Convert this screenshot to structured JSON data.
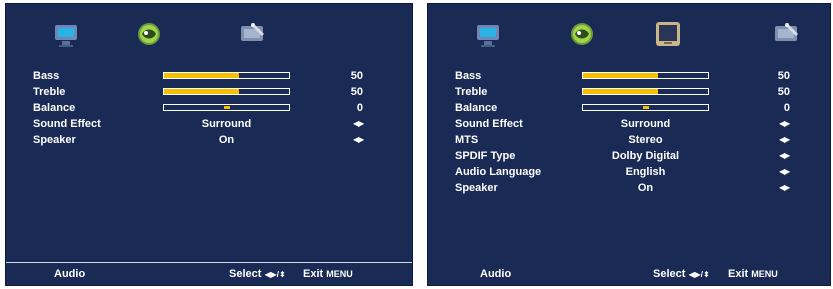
{
  "left": {
    "rows": [
      {
        "label": "Bass",
        "type": "slider",
        "value": "50",
        "level": 0.5
      },
      {
        "label": "Treble",
        "type": "slider",
        "value": "50",
        "level": 0.5
      },
      {
        "label": "Balance",
        "type": "balance",
        "value": "0",
        "level": 0.5
      },
      {
        "label": "Sound Effect",
        "type": "option",
        "value": "Surround",
        "arrows": "◀▶"
      },
      {
        "label": "Speaker",
        "type": "option",
        "value": "On",
        "arrows": "◀▶"
      }
    ],
    "footer": {
      "title": "Audio",
      "select": "Select",
      "nav": "◀▶/⬍",
      "exit": "Exit",
      "menu": "MENU"
    }
  },
  "right": {
    "rows": [
      {
        "label": "Bass",
        "type": "slider",
        "value": "50",
        "level": 0.5
      },
      {
        "label": "Treble",
        "type": "slider",
        "value": "50",
        "level": 0.5
      },
      {
        "label": "Balance",
        "type": "balance",
        "value": "0",
        "level": 0.5
      },
      {
        "label": "Sound Effect",
        "type": "option",
        "value": "Surround",
        "arrows": "◀▶"
      },
      {
        "label": "MTS",
        "type": "option",
        "value": "Stereo",
        "arrows": "◀▶"
      },
      {
        "label": "SPDIF Type",
        "type": "option",
        "value": "Dolby Digital",
        "arrows": "◀▶"
      },
      {
        "label": "Audio Language",
        "type": "option",
        "value": "English",
        "arrows": "◀▶"
      },
      {
        "label": "Speaker",
        "type": "option",
        "value": "On",
        "arrows": "◀▶"
      }
    ],
    "footer": {
      "title": "Audio",
      "select": "Select",
      "nav": "◀▶/⬍",
      "exit": "Exit",
      "menu": "MENU"
    }
  },
  "colors": {
    "panel": "#192a55",
    "accent": "#f5c000",
    "text": "#ffffff"
  },
  "icons": {
    "left": [
      "picture-icon",
      "sound-icon",
      "setup-icon"
    ],
    "right": [
      "picture-icon",
      "sound-icon",
      "tv-channel-icon",
      "setup-icon"
    ]
  }
}
